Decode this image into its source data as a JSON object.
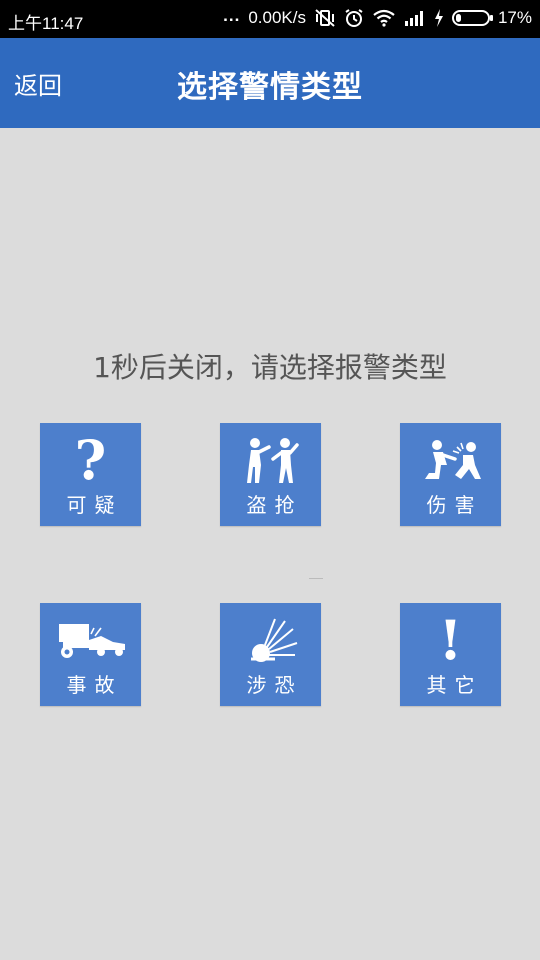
{
  "status_bar": {
    "time": "上午11:47",
    "dots": "...",
    "net_speed": "0.00K/s",
    "battery": "17%",
    "battery_level": 0.17
  },
  "header": {
    "back_label": "返回",
    "title": "选择警情类型"
  },
  "notice": "1秒后关闭，请选择报警类型",
  "categories": [
    {
      "label": "可疑",
      "icon": "question-icon",
      "glyph": "?"
    },
    {
      "label": "盗抢",
      "icon": "robbery-icon"
    },
    {
      "label": "伤害",
      "icon": "assault-icon"
    },
    {
      "label": "事故",
      "icon": "accident-icon"
    },
    {
      "label": "涉恐",
      "icon": "explosion-icon"
    },
    {
      "label": "其它",
      "icon": "exclamation-icon",
      "glyph": "!"
    }
  ],
  "colors": {
    "header": "#2f6abf",
    "tile": "#4d7fcc",
    "background": "#dcdcdc"
  }
}
